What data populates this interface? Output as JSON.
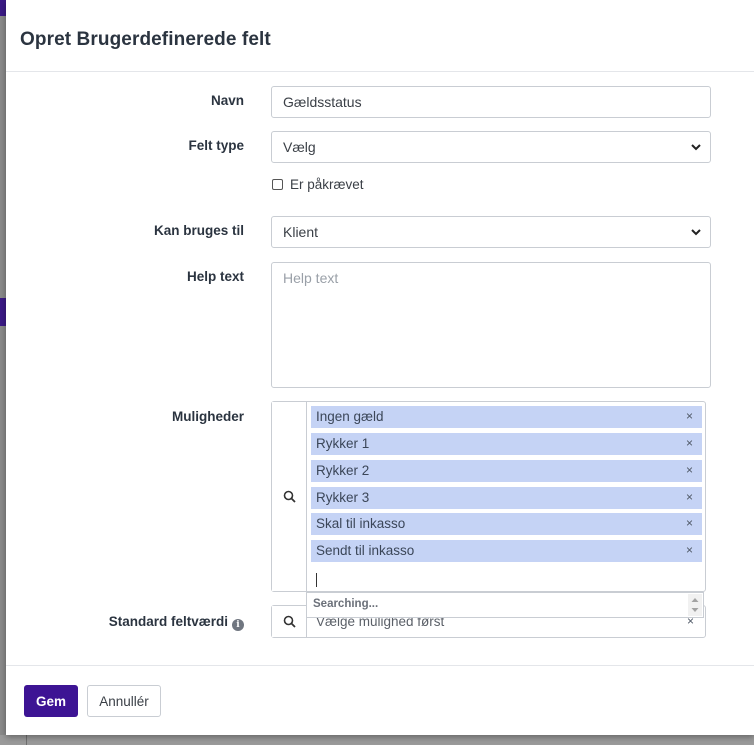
{
  "dialog": {
    "title": "Opret Brugerdefinerede felt"
  },
  "form": {
    "name": {
      "label": "Navn",
      "value": "Gældsstatus"
    },
    "field_type": {
      "label": "Felt type",
      "value": "Vælg"
    },
    "required": {
      "label": "Er påkrævet",
      "checked": false
    },
    "usable_for": {
      "label": "Kan bruges til",
      "value": "Klient"
    },
    "help_text": {
      "label": "Help text",
      "placeholder": "Help text",
      "value": ""
    },
    "options": {
      "label": "Muligheder",
      "tags": [
        "Ingen gæld",
        "Rykker 1",
        "Rykker 2",
        "Rykker 3",
        "Skal til inkasso",
        "Sendt til inkasso"
      ],
      "remove_glyph": "×",
      "dropdown_status": "Searching..."
    },
    "default_value": {
      "label": "Standard feltværdi",
      "placeholder": "Vælge mulighed først",
      "clear_glyph": "×",
      "info_glyph": "i"
    }
  },
  "footer": {
    "save_label": "Gem",
    "cancel_label": "Annullér"
  },
  "colors": {
    "primary": "#3d1494",
    "tag_bg": "#c5d3f5"
  },
  "icons": {
    "search": "search-icon",
    "chevron": "chevron-down-icon",
    "info": "info-icon",
    "remove": "close-icon"
  }
}
